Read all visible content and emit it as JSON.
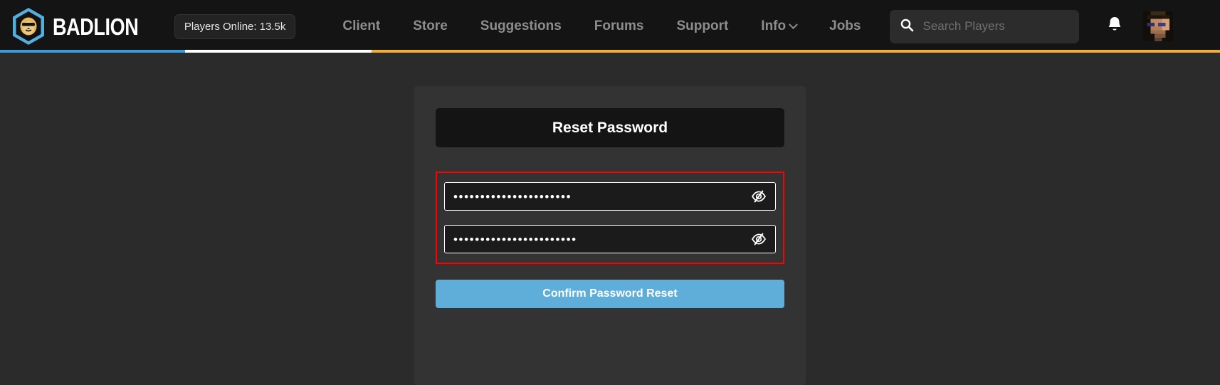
{
  "header": {
    "brand_name": "BADLION",
    "brand_logo_icon": "lion-hexagon-logo",
    "players_online": "Players Online: 13.5k",
    "nav": [
      {
        "label": "Client",
        "has_dropdown": false
      },
      {
        "label": "Store",
        "has_dropdown": false
      },
      {
        "label": "Suggestions",
        "has_dropdown": false
      },
      {
        "label": "Forums",
        "has_dropdown": false
      },
      {
        "label": "Support",
        "has_dropdown": false
      },
      {
        "label": "Info",
        "has_dropdown": true
      },
      {
        "label": "Jobs",
        "has_dropdown": false
      }
    ],
    "search": {
      "placeholder": "Search Players",
      "value": "",
      "icon": "search-icon"
    },
    "notifications_icon": "bell-icon",
    "avatar_icon": "user-avatar",
    "accent_bar": {
      "blue": "#3d9bd6",
      "white": "#ffffff",
      "gold": "#f0ae3c"
    }
  },
  "main": {
    "card": {
      "title": "Reset Password",
      "fields": [
        {
          "name": "new-password",
          "value_masked": "••••••••••••••••••••••",
          "toggle_icon": "eye-slash-icon",
          "toggle_state": "hidden"
        },
        {
          "name": "confirm-password",
          "value_masked": "•••••••••••••••••••••••",
          "toggle_icon": "eye-slash-icon",
          "toggle_state": "hidden"
        }
      ],
      "highlight_color": "#ff0000",
      "submit_label": "Confirm Password Reset",
      "submit_color": "#5eaed9"
    }
  }
}
